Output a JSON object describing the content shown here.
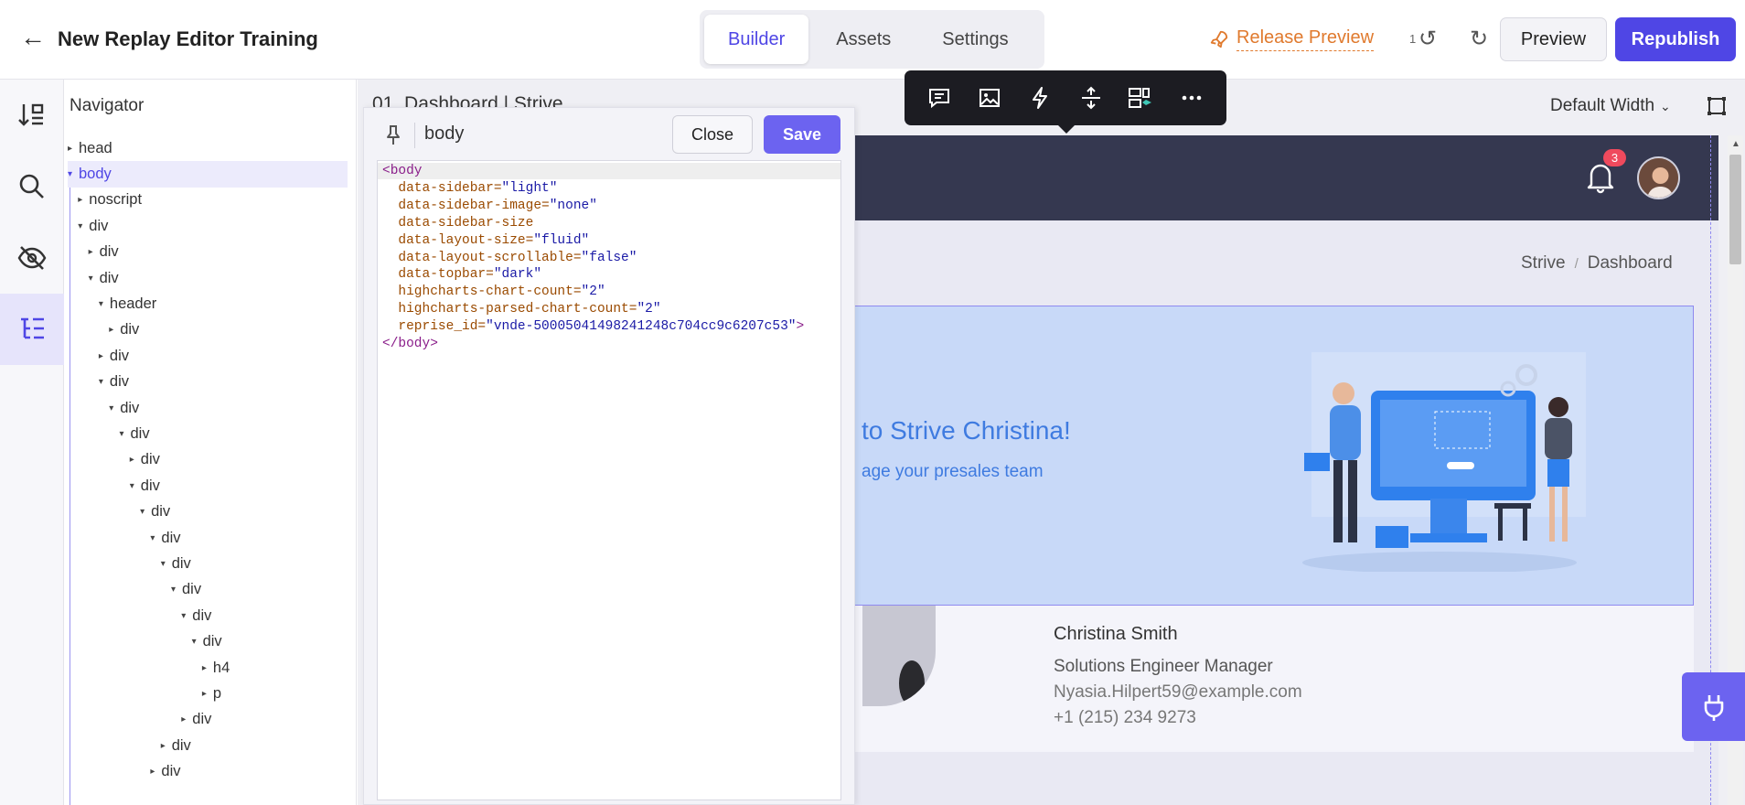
{
  "header": {
    "title": "New Replay Editor Training",
    "tabs": [
      {
        "label": "Builder",
        "active": true
      },
      {
        "label": "Assets",
        "active": false
      },
      {
        "label": "Settings",
        "active": false
      }
    ],
    "release_preview": "Release Preview",
    "undo_count": "1",
    "preview_label": "Preview",
    "republish_label": "Republish"
  },
  "navigator": {
    "title": "Navigator",
    "nodes": [
      {
        "label": "head",
        "indent": 0,
        "caret": "▸"
      },
      {
        "label": "body",
        "indent": 0,
        "caret": "▾",
        "selected": true
      },
      {
        "label": "noscript",
        "indent": 1,
        "caret": "▸"
      },
      {
        "label": "div",
        "indent": 1,
        "caret": "▾"
      },
      {
        "label": "div",
        "indent": 2,
        "caret": "▸"
      },
      {
        "label": "div",
        "indent": 2,
        "caret": "▾"
      },
      {
        "label": "header",
        "indent": 3,
        "caret": "▾"
      },
      {
        "label": "div",
        "indent": 4,
        "caret": "▸"
      },
      {
        "label": "div",
        "indent": 3,
        "caret": "▸"
      },
      {
        "label": "div",
        "indent": 3,
        "caret": "▾"
      },
      {
        "label": "div",
        "indent": 4,
        "caret": "▾"
      },
      {
        "label": "div",
        "indent": 5,
        "caret": "▾"
      },
      {
        "label": "div",
        "indent": 6,
        "caret": "▸"
      },
      {
        "label": "div",
        "indent": 6,
        "caret": "▾"
      },
      {
        "label": "div",
        "indent": 7,
        "caret": "▾"
      },
      {
        "label": "div",
        "indent": 8,
        "caret": "▾"
      },
      {
        "label": "div",
        "indent": 9,
        "caret": "▾"
      },
      {
        "label": "div",
        "indent": 10,
        "caret": "▾"
      },
      {
        "label": "div",
        "indent": 11,
        "caret": "▾"
      },
      {
        "label": "div",
        "indent": 12,
        "caret": "▾"
      },
      {
        "label": "h4",
        "indent": 13,
        "caret": "▸"
      },
      {
        "label": "p",
        "indent": 13,
        "caret": "▸"
      },
      {
        "label": "div",
        "indent": 11,
        "caret": "▸"
      },
      {
        "label": "div",
        "indent": 9,
        "caret": "▸"
      },
      {
        "label": "div",
        "indent": 8,
        "caret": "▸"
      }
    ]
  },
  "canvas": {
    "page_title": "01. Dashboard | Strive",
    "width_option": "Default Width",
    "notification_count": "3",
    "breadcrumb": [
      "Strive",
      "/",
      "Dashboard"
    ],
    "hero_title": "to Strive Christina!",
    "hero_subtitle": "age your presales team",
    "profile": {
      "name": "Christina Smith",
      "role": "Solutions Engineer Manager",
      "email": "Nyasia.Hilpert59@example.com",
      "phone": "+1 (215) 234 9273"
    }
  },
  "code_panel": {
    "label": "body",
    "close_label": "Close",
    "save_label": "Save",
    "lines": [
      [
        {
          "t": "tg",
          "v": "<body"
        }
      ],
      [
        {
          "t": "at",
          "v": "  data-sidebar="
        },
        {
          "t": "vl",
          "v": "\"light\""
        }
      ],
      [
        {
          "t": "at",
          "v": "  data-sidebar-image="
        },
        {
          "t": "vl",
          "v": "\"none\""
        }
      ],
      [
        {
          "t": "at",
          "v": "  data-sidebar-size"
        }
      ],
      [
        {
          "t": "at",
          "v": "  data-layout-size="
        },
        {
          "t": "vl",
          "v": "\"fluid\""
        }
      ],
      [
        {
          "t": "at",
          "v": "  data-layout-scrollable="
        },
        {
          "t": "vl",
          "v": "\"false\""
        }
      ],
      [
        {
          "t": "at",
          "v": "  data-topbar="
        },
        {
          "t": "vl",
          "v": "\"dark\""
        }
      ],
      [
        {
          "t": "at",
          "v": "  highcharts-chart-count="
        },
        {
          "t": "vl",
          "v": "\"2\""
        }
      ],
      [
        {
          "t": "at",
          "v": "  highcharts-parsed-chart-count="
        },
        {
          "t": "vl",
          "v": "\"2\""
        }
      ],
      [
        {
          "t": "at",
          "v": "  reprise_id="
        },
        {
          "t": "vl",
          "v": "\"vnde-50005041498241248c704cc9c6207c53\""
        },
        {
          "t": "tg",
          "v": ">"
        }
      ],
      [
        {
          "t": "tg",
          "v": "</body>"
        }
      ]
    ]
  },
  "colors": {
    "accent": "#4f46e5",
    "release": "#e07a2e",
    "site_header": "#353850",
    "hero_bg": "#c8d9f8",
    "badge": "#ef4a5d"
  }
}
